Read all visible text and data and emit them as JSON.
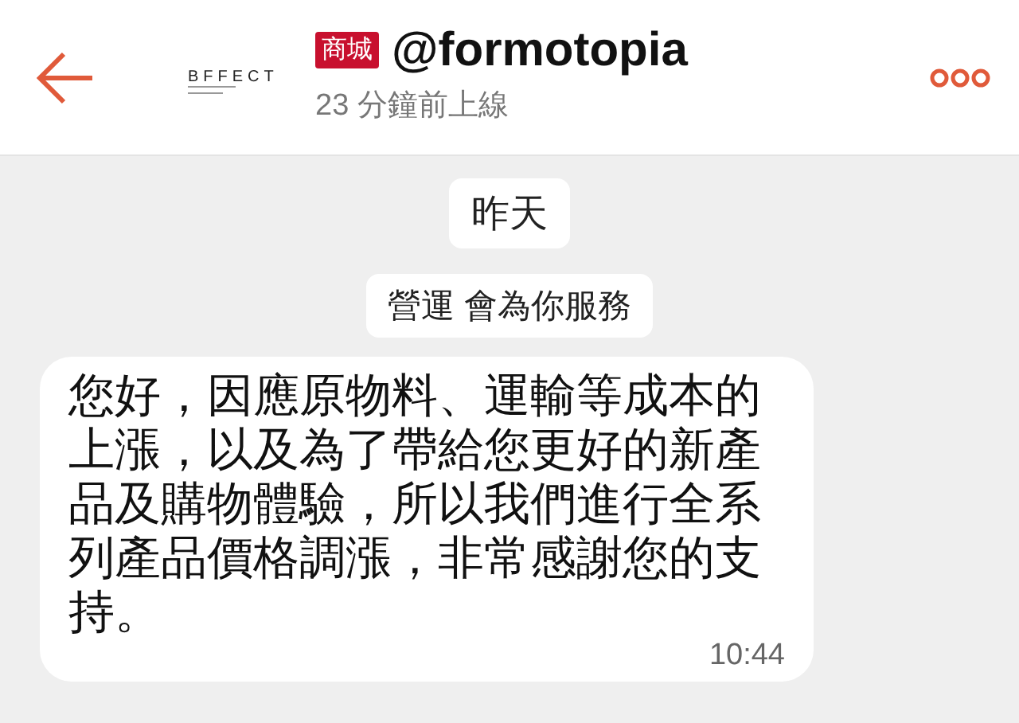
{
  "header": {
    "logo": "BFFECT",
    "badge": "商城",
    "name": "@formotopia",
    "status": "23 分鐘前上線"
  },
  "messages": [
    {
      "kind": "date",
      "text": "昨天"
    },
    {
      "kind": "system",
      "text": "營運 會為你服務"
    },
    {
      "kind": "bubble",
      "text": "您好，因應原物料、運輸等成本的上漲，以及為了帶給您更好的新產品及購物體驗，所以我們進行全系列產品價格調漲，非常感謝您的支持。",
      "time": "10:44"
    }
  ]
}
